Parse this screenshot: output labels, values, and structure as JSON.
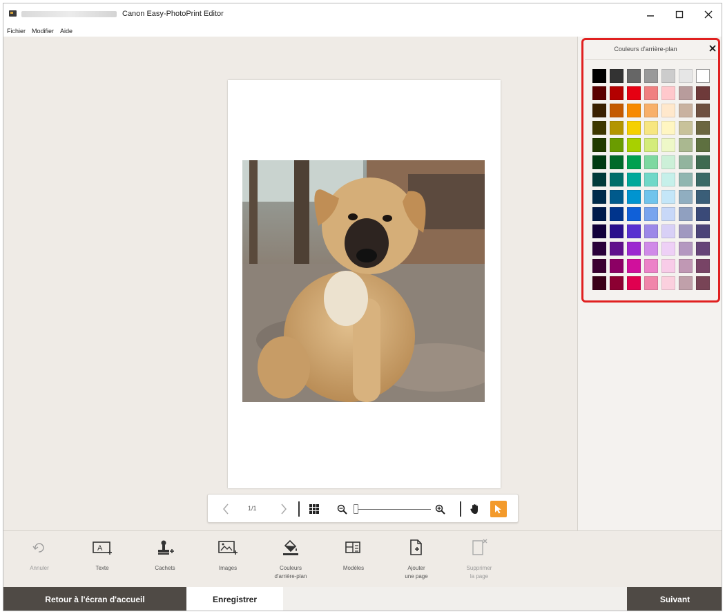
{
  "window": {
    "title": "Canon Easy-PhotoPrint Editor",
    "controls": [
      "minimize",
      "maximize",
      "close"
    ]
  },
  "menu": {
    "items": [
      "Fichier",
      "Modifier",
      "Aide"
    ]
  },
  "canvas": {
    "page_counter": "1/1",
    "zoom_level": 0,
    "active_tool": "select"
  },
  "panel": {
    "title": "Couleurs d'arrière-plan",
    "swatches": [
      [
        "#000000",
        "#333333",
        "#666666",
        "#999999",
        "#cccccc",
        "#e6e6e6",
        "#ffffff"
      ],
      [
        "#5a0000",
        "#b30000",
        "#e60012",
        "#f08080",
        "#ffc8cc",
        "#b89c9c",
        "#6e3a3a"
      ],
      [
        "#3a2000",
        "#c45a00",
        "#f78a00",
        "#f8b06a",
        "#ffe8cc",
        "#c9b2a0",
        "#6e5040"
      ],
      [
        "#3d3700",
        "#b39500",
        "#f5d000",
        "#f7e680",
        "#fff6c2",
        "#c8c29a",
        "#6b6640"
      ],
      [
        "#203a00",
        "#6a9c00",
        "#a8d000",
        "#d4ec7a",
        "#eef8c8",
        "#aab890",
        "#5e7040"
      ],
      [
        "#003a12",
        "#006a2a",
        "#00a050",
        "#7ed8a0",
        "#ccf0d8",
        "#92b49e",
        "#3e6a50"
      ],
      [
        "#003a3a",
        "#006e6a",
        "#00a89a",
        "#70d8c8",
        "#c6f0ea",
        "#90b6b0",
        "#3a6a66"
      ],
      [
        "#002a4a",
        "#005a8c",
        "#0094d0",
        "#70c4ec",
        "#c4e6f8",
        "#90aec0",
        "#3a5e78"
      ],
      [
        "#001a4a",
        "#00348c",
        "#1060d8",
        "#78a4ee",
        "#c8d8f8",
        "#90a0c0",
        "#3a4a78"
      ],
      [
        "#12003a",
        "#2a108c",
        "#5830d0",
        "#9c88e8",
        "#d8d0f6",
        "#a098c0",
        "#4c4478"
      ],
      [
        "#2a003a",
        "#60108c",
        "#9c28d0",
        "#d08ae8",
        "#eed0f6",
        "#b498c0",
        "#664478"
      ],
      [
        "#3a0030",
        "#8c0064",
        "#d0109c",
        "#ec82c8",
        "#f8cce8",
        "#c098b4",
        "#784466"
      ],
      [
        "#3a0018",
        "#8c0032",
        "#e00050",
        "#f086aa",
        "#fbd0de",
        "#c0a0aa",
        "#784456"
      ]
    ]
  },
  "toolbar": {
    "undo": "Annuler",
    "text": "Texte",
    "stamps": "Cachets",
    "images": "Images",
    "bg_colors_line1": "Couleurs",
    "bg_colors_line2": "d'arrière-plan",
    "templates": "Modèles",
    "add_page_line1": "Ajouter",
    "add_page_line2": "une page",
    "delete_page_line1": "Supprimer",
    "delete_page_line2": "la page"
  },
  "footer": {
    "home": "Retour à l'écran d'accueil",
    "save": "Enregistrer",
    "next": "Suivant"
  }
}
